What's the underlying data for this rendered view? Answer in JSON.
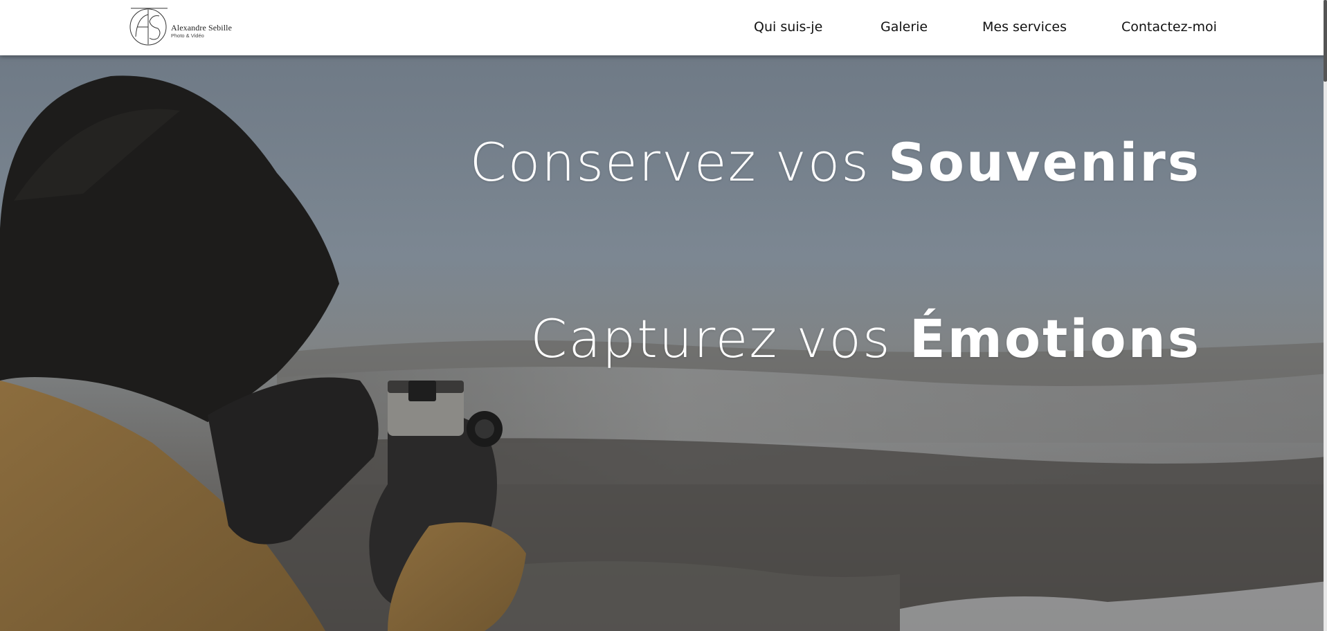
{
  "brand": {
    "name": "Alexandre Sebille",
    "tagline": "Photo & Vidéo"
  },
  "nav": {
    "items": [
      "Qui suis-je",
      "Galerie",
      "Mes services",
      "Contactez-moi"
    ]
  },
  "hero": {
    "line1": {
      "light": "Conservez vos",
      "bold": "Souvenirs"
    },
    "line2": {
      "light": "Capturez vos",
      "bold": "Émotions"
    }
  },
  "colors": {
    "header_bg": "#ffffff",
    "nav_text": "#111111",
    "hero_text": "#ffffff"
  },
  "icons": {
    "logo": "as-monogram-logo"
  }
}
